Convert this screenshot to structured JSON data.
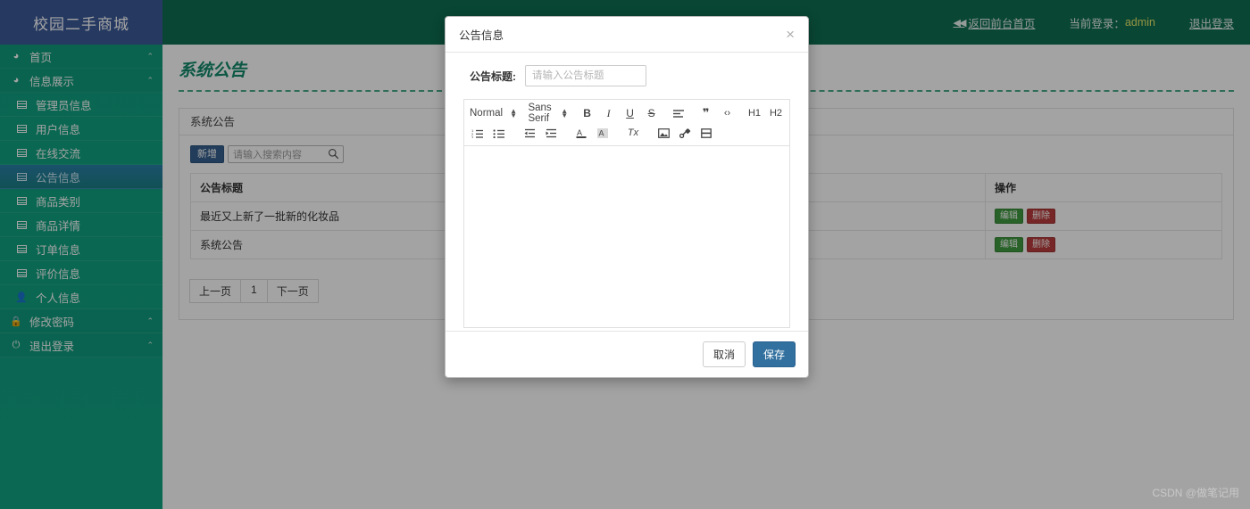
{
  "brand": {
    "title": "校园二手商城"
  },
  "colors": {
    "sidebar": "#14a085",
    "logo_bg": "#3b5998",
    "topbar": "#0f6e52",
    "accent_title": "#138a6b",
    "username": "#e8e86a",
    "active_item": "#2a7fa8",
    "btn_primary": "#34608f",
    "btn_edit": "#3f9a3f",
    "btn_delete": "#b93c3c",
    "btn_save": "#31709f"
  },
  "topbar": {
    "back_home": "返回前台首页",
    "current_login_label": "当前登录：",
    "username": "admin",
    "logout": "退出登录"
  },
  "sidebar": {
    "items": [
      {
        "label": "首页",
        "icon": "dashboard-icon",
        "level": "top",
        "caret": "⌃",
        "active": false
      },
      {
        "label": "信息展示",
        "icon": "dashboard-icon",
        "level": "top",
        "caret": "⌃",
        "active": false
      },
      {
        "label": "管理员信息",
        "icon": "table-icon",
        "level": "sub",
        "caret": "",
        "active": false
      },
      {
        "label": "用户信息",
        "icon": "table-icon",
        "level": "sub",
        "caret": "",
        "active": false
      },
      {
        "label": "在线交流",
        "icon": "table-icon",
        "level": "sub",
        "caret": "",
        "active": false
      },
      {
        "label": "公告信息",
        "icon": "table-icon",
        "level": "sub",
        "caret": "",
        "active": true
      },
      {
        "label": "商品类别",
        "icon": "table-icon",
        "level": "sub",
        "caret": "",
        "active": false
      },
      {
        "label": "商品详情",
        "icon": "table-icon",
        "level": "sub",
        "caret": "",
        "active": false
      },
      {
        "label": "订单信息",
        "icon": "table-icon",
        "level": "sub",
        "caret": "",
        "active": false
      },
      {
        "label": "评价信息",
        "icon": "table-icon",
        "level": "sub",
        "caret": "",
        "active": false
      },
      {
        "label": "个人信息",
        "icon": "person-icon",
        "level": "sub",
        "caret": "",
        "active": false
      },
      {
        "label": "修改密码",
        "icon": "lock-icon",
        "level": "top",
        "caret": "⌃",
        "active": false
      },
      {
        "label": "退出登录",
        "icon": "power-icon",
        "level": "top",
        "caret": "⌃",
        "active": false
      }
    ]
  },
  "page": {
    "title": "系统公告",
    "panel_title": "系统公告"
  },
  "toolbar": {
    "add_label": "新增",
    "search_placeholder": "请输入搜索内容",
    "search_value": "",
    "search_icon": "search-icon"
  },
  "table": {
    "columns": [
      "公告标题",
      "操作"
    ],
    "rows": [
      {
        "title": "最近又上新了一批新的化妆品",
        "edit": "编辑",
        "delete": "删除"
      },
      {
        "title": "系统公告",
        "edit": "编辑",
        "delete": "删除"
      }
    ]
  },
  "pagination": {
    "prev": "上一页",
    "current": "1",
    "next": "下一页"
  },
  "modal": {
    "title": "公告信息",
    "close_icon": "close-icon",
    "field_label": "公告标题:",
    "field_placeholder": "请输入公告标题",
    "field_value": "",
    "cancel": "取消",
    "save": "保存",
    "editor": {
      "content": "",
      "toolbar_row1": [
        {
          "name": "header-picker",
          "label": "Normal",
          "type": "picker"
        },
        {
          "name": "font-picker",
          "label": "Sans Serif",
          "type": "picker"
        },
        {
          "name": "bold-icon",
          "label": "B",
          "type": "btn"
        },
        {
          "name": "italic-icon",
          "label": "I",
          "type": "btn"
        },
        {
          "name": "underline-icon",
          "label": "U",
          "type": "btn"
        },
        {
          "name": "strike-icon",
          "label": "S",
          "type": "btn"
        },
        {
          "name": "align-icon",
          "label": "≡",
          "type": "btn"
        },
        {
          "name": "blockquote-icon",
          "label": "❞",
          "type": "btn"
        },
        {
          "name": "code-block-icon",
          "label": "‹›",
          "type": "btn"
        },
        {
          "name": "header-1-icon",
          "label": "H1",
          "type": "btn"
        },
        {
          "name": "header-2-icon",
          "label": "H2",
          "type": "btn"
        }
      ],
      "toolbar_row2": [
        {
          "name": "ordered-list-icon",
          "label": "ol"
        },
        {
          "name": "bullet-list-icon",
          "label": "ul"
        },
        {
          "name": "outdent-icon",
          "label": "outdent"
        },
        {
          "name": "indent-icon",
          "label": "indent"
        },
        {
          "name": "text-color-icon",
          "label": "A"
        },
        {
          "name": "background-color-icon",
          "label": "A"
        },
        {
          "name": "clean-format-icon",
          "label": "Tx"
        },
        {
          "name": "image-icon",
          "label": "image"
        },
        {
          "name": "link-icon",
          "label": "link"
        },
        {
          "name": "video-icon",
          "label": "video"
        }
      ]
    }
  },
  "watermark": {
    "text": "CSDN @做笔记用"
  }
}
